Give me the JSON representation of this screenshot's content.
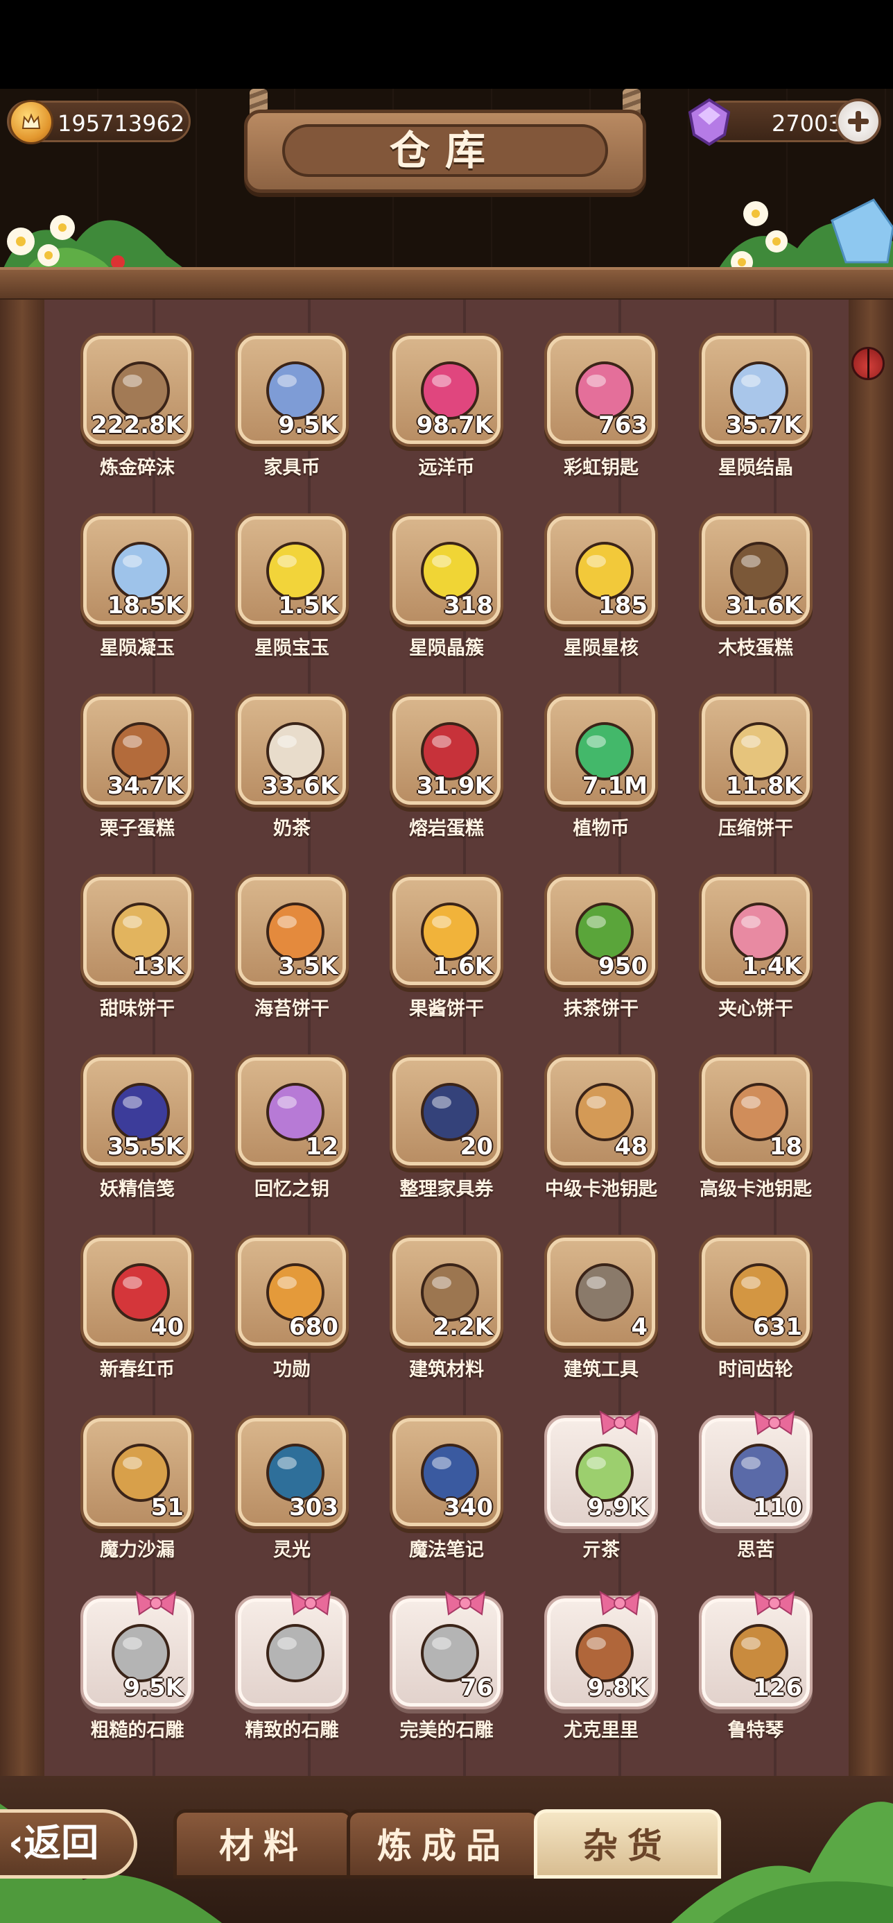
{
  "header": {
    "title": "仓库",
    "coins": "195713962",
    "gems": "27003"
  },
  "items": [
    {
      "name": "炼金碎沫",
      "count": "222.8K",
      "icon": "rock-shards-icon",
      "color": "#a27a55",
      "gift": false
    },
    {
      "name": "家具币",
      "count": "9.5K",
      "icon": "furniture-coin-icon",
      "color": "#7e9cd6",
      "gift": false
    },
    {
      "name": "远洋币",
      "count": "98.7K",
      "icon": "ocean-coin-icon",
      "color": "#e0467e",
      "gift": false
    },
    {
      "name": "彩虹钥匙",
      "count": "763",
      "icon": "rainbow-key-icon",
      "color": "#e46f9a",
      "gift": false
    },
    {
      "name": "星陨结晶",
      "count": "35.7K",
      "icon": "crystal-icon",
      "color": "#a9c6ea",
      "gift": false
    },
    {
      "name": "星陨凝玉",
      "count": "18.5K",
      "icon": "star-gem-icon",
      "color": "#9ec3ea",
      "gift": false
    },
    {
      "name": "星陨宝玉",
      "count": "1.5K",
      "icon": "yellow-crystal-icon",
      "color": "#f2d43a",
      "gift": false
    },
    {
      "name": "星陨晶簇",
      "count": "318",
      "icon": "yellow-star-icon",
      "color": "#f0d535",
      "gift": false
    },
    {
      "name": "星陨星核",
      "count": "185",
      "icon": "star-core-icon",
      "color": "#f2c93a",
      "gift": false
    },
    {
      "name": "木枝蛋糕",
      "count": "31.6K",
      "icon": "log-cake-icon",
      "color": "#7b5838",
      "gift": false
    },
    {
      "name": "栗子蛋糕",
      "count": "34.7K",
      "icon": "chestnut-cake-icon",
      "color": "#b36b3b",
      "gift": false
    },
    {
      "name": "奶茶",
      "count": "33.6K",
      "icon": "milk-tea-icon",
      "color": "#e8dccb",
      "gift": false
    },
    {
      "name": "熔岩蛋糕",
      "count": "31.9K",
      "icon": "lava-cake-icon",
      "color": "#c7323a",
      "gift": false
    },
    {
      "name": "植物币",
      "count": "7.1M",
      "icon": "plant-coin-icon",
      "color": "#43b86a",
      "gift": false
    },
    {
      "name": "压缩饼干",
      "count": "11.8K",
      "icon": "compressed-biscuit-icon",
      "color": "#e6c47c",
      "gift": false
    },
    {
      "name": "甜味饼干",
      "count": "13K",
      "icon": "sweet-cracker-icon",
      "color": "#e2b45e",
      "gift": false
    },
    {
      "name": "海苔饼干",
      "count": "3.5K",
      "icon": "seaweed-cracker-icon",
      "color": "#e48a3d",
      "gift": false
    },
    {
      "name": "果酱饼干",
      "count": "1.6K",
      "icon": "jam-cookie-icon",
      "color": "#f1b33a",
      "gift": false
    },
    {
      "name": "抹茶饼干",
      "count": "950",
      "icon": "matcha-cookie-icon",
      "color": "#5aa53a",
      "gift": false
    },
    {
      "name": "夹心饼干",
      "count": "1.4K",
      "icon": "sandwich-cookie-icon",
      "color": "#e88aa2",
      "gift": false
    },
    {
      "name": "妖精信笺",
      "count": "35.5K",
      "icon": "fairy-letter-icon",
      "color": "#3c3c9a",
      "gift": false
    },
    {
      "name": "回忆之钥",
      "count": "12",
      "icon": "memory-key-icon",
      "color": "#b77ad6",
      "gift": false
    },
    {
      "name": "整理家具券",
      "count": "20",
      "icon": "furniture-ticket-icon",
      "color": "#34427a",
      "gift": false
    },
    {
      "name": "中级卡池钥匙",
      "count": "48",
      "icon": "gold-key-icon",
      "color": "#d49a56",
      "gift": false
    },
    {
      "name": "高级卡池钥匙",
      "count": "18",
      "icon": "gold-key-icon",
      "color": "#d08d5a",
      "gift": false
    },
    {
      "name": "新春红币",
      "count": "40",
      "icon": "red-coin-icon",
      "color": "#d4363a",
      "gift": false
    },
    {
      "name": "功勋",
      "count": "680",
      "icon": "medal-icon",
      "color": "#e49a3a",
      "gift": false
    },
    {
      "name": "建筑材料",
      "count": "2.2K",
      "icon": "building-material-icon",
      "color": "#9c7650",
      "gift": false
    },
    {
      "name": "建筑工具",
      "count": "4",
      "icon": "hammer-icon",
      "color": "#8a7a6a",
      "gift": false
    },
    {
      "name": "时间齿轮",
      "count": "631",
      "icon": "gears-icon",
      "color": "#d39642",
      "gift": false
    },
    {
      "name": "魔力沙漏",
      "count": "51",
      "icon": "hourglass-icon",
      "color": "#d8a04a",
      "gift": false
    },
    {
      "name": "灵光",
      "count": "303",
      "icon": "lightbulb-icon",
      "color": "#2e6f9a",
      "gift": false
    },
    {
      "name": "魔法笔记",
      "count": "340",
      "icon": "magic-book-icon",
      "color": "#3a5aa0",
      "gift": false
    },
    {
      "name": "亓茶",
      "count": "9.9K",
      "icon": "tea-bowl-icon",
      "color": "#9ccf6e",
      "gift": true
    },
    {
      "name": "思苦",
      "count": "110",
      "icon": "cup-icon",
      "color": "#5a6aa8",
      "gift": true
    },
    {
      "name": "粗糙的石雕",
      "count": "9.5K",
      "icon": "statue-icon",
      "color": "#b4b4b4",
      "gift": true
    },
    {
      "name": "精致的石雕",
      "count": "",
      "icon": "bird-statue-icon",
      "color": "#b4b4b4",
      "gift": true
    },
    {
      "name": "完美的石雕",
      "count": "76",
      "icon": "figure-statue-icon",
      "color": "#b4b4b4",
      "gift": true
    },
    {
      "name": "尤克里里",
      "count": "9.8K",
      "icon": "ukulele-icon",
      "color": "#b0663a",
      "gift": true
    },
    {
      "name": "鲁特琴",
      "count": "126",
      "icon": "lute-icon",
      "color": "#c98b3e",
      "gift": true
    }
  ],
  "tabs": {
    "back": "返回",
    "materials": "材料",
    "products": "炼成品",
    "misc": "杂货"
  }
}
